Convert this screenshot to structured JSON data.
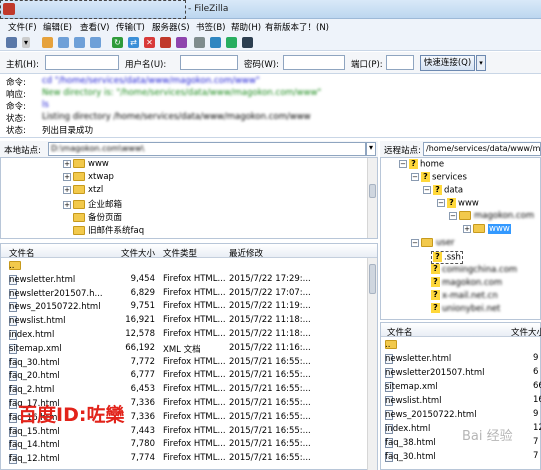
{
  "window": {
    "title": "- FileZilla"
  },
  "menu": [
    "文件(F)",
    "编辑(E)",
    "查看(V)",
    "传输(T)",
    "服务器(S)",
    "书签(B)",
    "帮助(H)",
    "有新版本了！(N)"
  ],
  "quickconnect": {
    "host_label": "主机(H):",
    "user_label": "用户名(U):",
    "pass_label": "密码(W):",
    "port_label": "端口(P):",
    "connect_button": "快速连接(Q)"
  },
  "log": [
    {
      "label": "命令:",
      "message": "cd \"/home/services/data/www/magokon.com/www\"",
      "color": "#1a1ad4",
      "blurred": true
    },
    {
      "label": "响应:",
      "message": "New directory is: \"/home/services/data/www/magokon.com/www\"",
      "color": "#1a8a1a",
      "blurred": true
    },
    {
      "label": "命令:",
      "message": "ls",
      "color": "#1a1ad4",
      "blurred": true
    },
    {
      "label": "状态:",
      "message": "Listing directory /home/services/data/www/magokon.com/www",
      "color": "#000000",
      "blurred": true
    },
    {
      "label": "状态:",
      "message": "列出目录成功",
      "color": "#000000",
      "blurred": false
    }
  ],
  "local": {
    "path_label": "本地站点:",
    "path_value": "D:\\magokon.com\\www\\",
    "tree": [
      {
        "name": "www",
        "expander": "+"
      },
      {
        "name": "xtwap",
        "expander": "+"
      },
      {
        "name": "xtzl",
        "expander": "+"
      },
      {
        "name": "企业邮箱",
        "expander": "+"
      },
      {
        "name": "备份页面",
        "expander": ""
      },
      {
        "name": "旧邮件系统faq",
        "expander": ""
      }
    ],
    "columns": [
      "文件名",
      "文件大小",
      "文件类型",
      "最近修改"
    ],
    "files": [
      {
        "name": "..",
        "size": "",
        "type": "",
        "modified": "",
        "folder": true
      },
      {
        "name": "newsletter.html",
        "size": "9,454",
        "type": "Firefox HTML...",
        "modified": "2015/7/22 17:29:..."
      },
      {
        "name": "newsletter201507.h...",
        "size": "6,829",
        "type": "Firefox HTML...",
        "modified": "2015/7/22 17:07:..."
      },
      {
        "name": "news_20150722.html",
        "size": "9,751",
        "type": "Firefox HTML...",
        "modified": "2015/7/22 11:19:..."
      },
      {
        "name": "newslist.html",
        "size": "16,921",
        "type": "Firefox HTML...",
        "modified": "2015/7/22 11:18:..."
      },
      {
        "name": "index.html",
        "size": "12,578",
        "type": "Firefox HTML...",
        "modified": "2015/7/22 11:18:..."
      },
      {
        "name": "sitemap.xml",
        "size": "66,192",
        "type": "XML 文档",
        "modified": "2015/7/22 11:16:..."
      },
      {
        "name": "faq_30.html",
        "size": "7,772",
        "type": "Firefox HTML...",
        "modified": "2015/7/21 16:55:..."
      },
      {
        "name": "faq_20.html",
        "size": "6,777",
        "type": "Firefox HTML...",
        "modified": "2015/7/21 16:55:..."
      },
      {
        "name": "faq_2.html",
        "size": "6,453",
        "type": "Firefox HTML...",
        "modified": "2015/7/21 16:55:..."
      },
      {
        "name": "faq_17.html",
        "size": "7,336",
        "type": "Firefox HTML...",
        "modified": "2015/7/21 16:55:..."
      },
      {
        "name": "faq_16.html",
        "size": "7,336",
        "type": "Firefox HTML...",
        "modified": "2015/7/21 16:55:..."
      },
      {
        "name": "faq_15.html",
        "size": "7,443",
        "type": "Firefox HTML...",
        "modified": "2015/7/21 16:55:..."
      },
      {
        "name": "faq_14.html",
        "size": "7,780",
        "type": "Firefox HTML...",
        "modified": "2015/7/21 16:55:..."
      },
      {
        "name": "faq_12.html",
        "size": "7,774",
        "type": "Firefox HTML...",
        "modified": "2015/7/21 16:55:..."
      }
    ]
  },
  "remote": {
    "path_label": "远程站点:",
    "path_value": "/home/services/data/www/mag",
    "tree": [
      {
        "name": "home",
        "kind": "q",
        "expander": "−"
      },
      {
        "name": "services",
        "kind": "q",
        "expander": "−"
      },
      {
        "name": "data",
        "kind": "q",
        "expander": "−"
      },
      {
        "name": "www",
        "kind": "q",
        "expander": "−"
      },
      {
        "name": "magokon.com",
        "kind": "folder",
        "expander": "−",
        "blurred": true
      },
      {
        "name": "www",
        "kind": "folder",
        "expander": "+",
        "selected": true
      },
      {
        "name": "user",
        "kind": "folder",
        "expander": "−",
        "blurred": true
      },
      {
        "name": ".ssh",
        "kind": "q",
        "expander": ""
      },
      {
        "name": "comingchina.com",
        "kind": "q",
        "expander": "",
        "blurred": true
      },
      {
        "name": "magokon.com",
        "kind": "q",
        "expander": "",
        "blurred": true
      },
      {
        "name": "x-mail.net.cn",
        "kind": "q",
        "expander": "",
        "blurred": true
      },
      {
        "name": "unionybei.net",
        "kind": "q",
        "expander": "",
        "blurred": true
      }
    ],
    "columns": [
      "文件名",
      "文件大小"
    ],
    "files": [
      {
        "name": "..",
        "size": "",
        "folder": true
      },
      {
        "name": "newsletter.html",
        "size": "9"
      },
      {
        "name": "newsletter201507.html",
        "size": "6"
      },
      {
        "name": "sitemap.xml",
        "size": "66"
      },
      {
        "name": "newslist.html",
        "size": "16"
      },
      {
        "name": "news_20150722.html",
        "size": "9"
      },
      {
        "name": "index.html",
        "size": "12"
      },
      {
        "name": "faq_38.html",
        "size": "7"
      },
      {
        "name": "faq_30.html",
        "size": "7"
      }
    ]
  },
  "overlay": {
    "watermark": "百度ID:咗欒",
    "logo": "Bai 经验"
  }
}
